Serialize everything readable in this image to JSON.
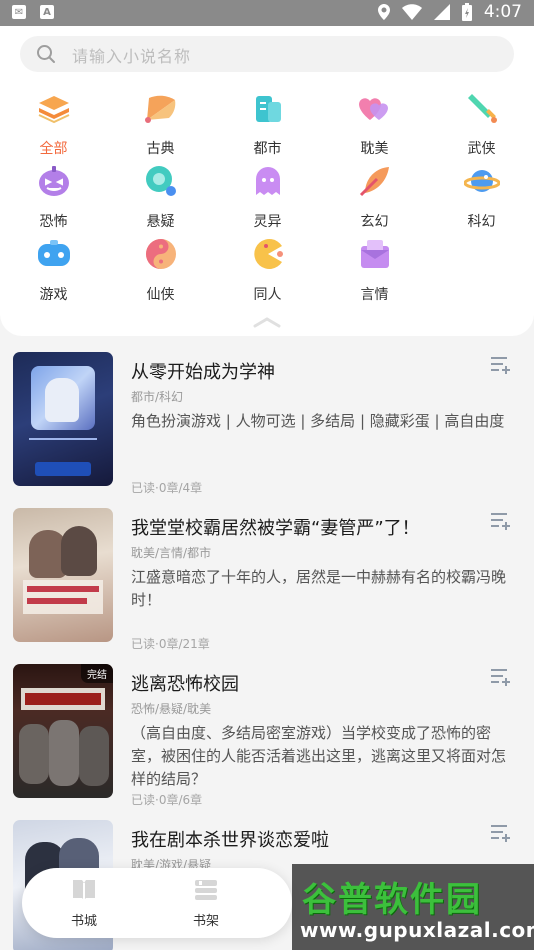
{
  "status_bar": {
    "time": "4:07"
  },
  "search": {
    "placeholder": "请输入小说名称"
  },
  "categories": [
    {
      "label": "全部",
      "icon": "layers-icon",
      "active": true
    },
    {
      "label": "古典",
      "icon": "fan-icon"
    },
    {
      "label": "都市",
      "icon": "building-icon"
    },
    {
      "label": "耽美",
      "icon": "hearts-icon"
    },
    {
      "label": "武侠",
      "icon": "sword-icon"
    },
    {
      "label": "恐怖",
      "icon": "pumpkin-icon"
    },
    {
      "label": "悬疑",
      "icon": "magnifier-icon"
    },
    {
      "label": "灵异",
      "icon": "ghost-icon"
    },
    {
      "label": "玄幻",
      "icon": "feather-icon"
    },
    {
      "label": "科幻",
      "icon": "planet-icon"
    },
    {
      "label": "游戏",
      "icon": "gamepad-icon"
    },
    {
      "label": "仙侠",
      "icon": "yinyang-icon"
    },
    {
      "label": "同人",
      "icon": "pacman-icon"
    },
    {
      "label": "言情",
      "icon": "envelope-icon"
    }
  ],
  "books": [
    {
      "title": "从零开始成为学神",
      "tags": "都市/科幻",
      "desc": "角色扮演游戏 | 人物可选 | 多结局 | 隐藏彩蛋 | 高自由度",
      "read": "已读·0章/4章",
      "cover_badge": ""
    },
    {
      "title": "我堂堂校霸居然被学霸“妻管严”了！",
      "tags": "耽美/言情/都市",
      "desc": "江盛意暗恋了十年的人，居然是一中赫赫有名的校霸冯晚时！",
      "read": "已读·0章/21章",
      "cover_badge": ""
    },
    {
      "title": "逃离恐怖校园",
      "tags": "恐怖/悬疑/耽美",
      "desc": "（高自由度、多结局密室游戏）当学校变成了恐怖的密室，被困住的人能否活着逃出这里，逃离这里又将面对怎样的结局？",
      "read": "已读·0章/6章",
      "cover_badge": "完结"
    },
    {
      "title": "我在剧本杀世界谈恋爱啦",
      "tags": "耽美/游戏/悬疑",
      "desc": "",
      "read": "",
      "cover_badge": ""
    }
  ],
  "tabbar": {
    "tabs": [
      {
        "label": "书城"
      },
      {
        "label": "书架"
      }
    ]
  },
  "watermark": {
    "main": "谷普软件园",
    "url": "www.gupuxlazal.com"
  },
  "colors": {
    "accent": "#f36a3e"
  }
}
